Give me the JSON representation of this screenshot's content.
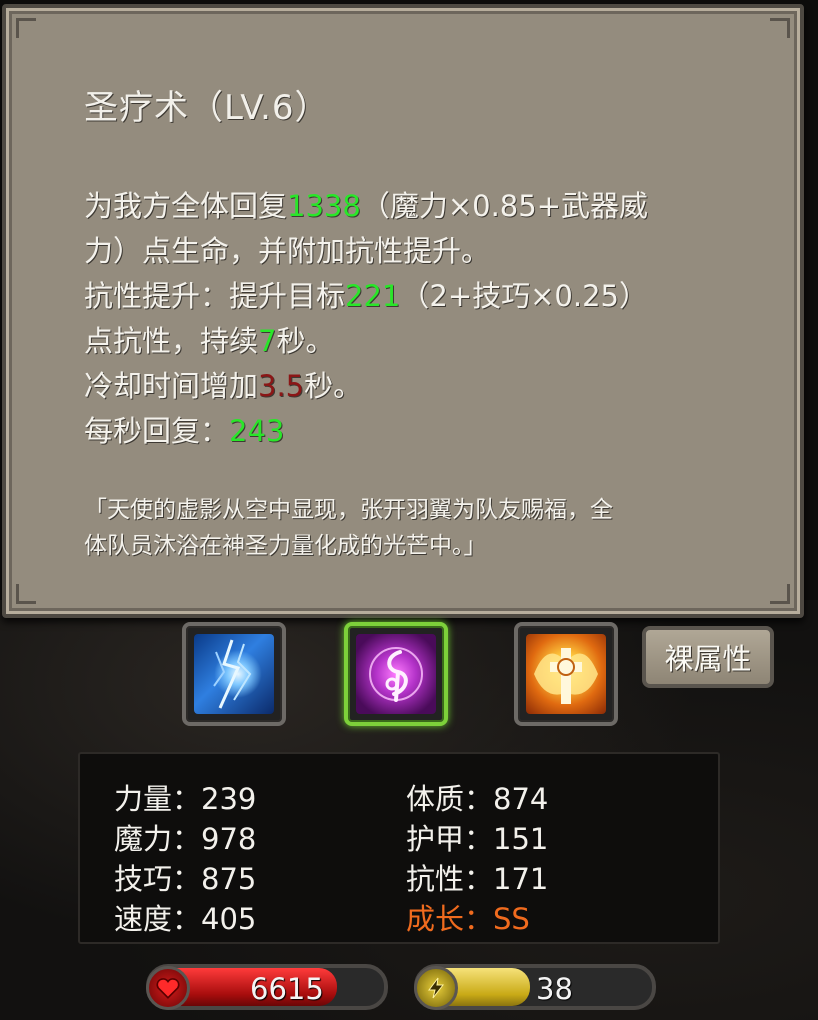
{
  "tooltip": {
    "title": "圣疗术（LV.6）",
    "desc_line1_a": "为我方全体回复",
    "desc_line1_val": "1338",
    "desc_line1_b": "（魔力×0.85+武器威",
    "desc_line2": "力）点生命，并附加抗性提升。",
    "desc_line3_a": "抗性提升：提升目标",
    "desc_line3_val": "221",
    "desc_line3_b": "（2+技巧×0.25）",
    "desc_line4_a": "点抗性，持续",
    "desc_line4_val": "7",
    "desc_line4_b": "秒。",
    "desc_line5_a": "冷却时间增加",
    "desc_line5_val": "3.5",
    "desc_line5_b": "秒。",
    "desc_line6_a": "每秒回复：",
    "desc_line6_val": "243",
    "flavor_line1": "「天使的虚影从空中显现，张开羽翼为队友赐福，全",
    "flavor_line2": "体队员沐浴在神圣力量化成的光芒中。」"
  },
  "skills": {
    "slot1_icon": "lightning-skill-icon",
    "slot2_icon": "holy-heal-skill-icon",
    "slot3_icon": "angel-cross-skill-icon",
    "selected_slot": 2
  },
  "attr_button": "裸属性",
  "stats": {
    "strength": "力量：239",
    "magic": "魔力：978",
    "skill": "技巧：875",
    "speed": "速度：405",
    "constitution": "体质：874",
    "armor": "护甲：151",
    "resistance": "抗性：171",
    "growth": "成长：SS"
  },
  "bars": {
    "hp_value": "6615",
    "hp_fill_fraction": 0.8,
    "mp_value": "38",
    "mp_fill_fraction": 0.48
  },
  "colors": {
    "highlight_green": "#29e629",
    "highlight_red": "#8b1616",
    "growth_orange": "#f06b1e"
  }
}
